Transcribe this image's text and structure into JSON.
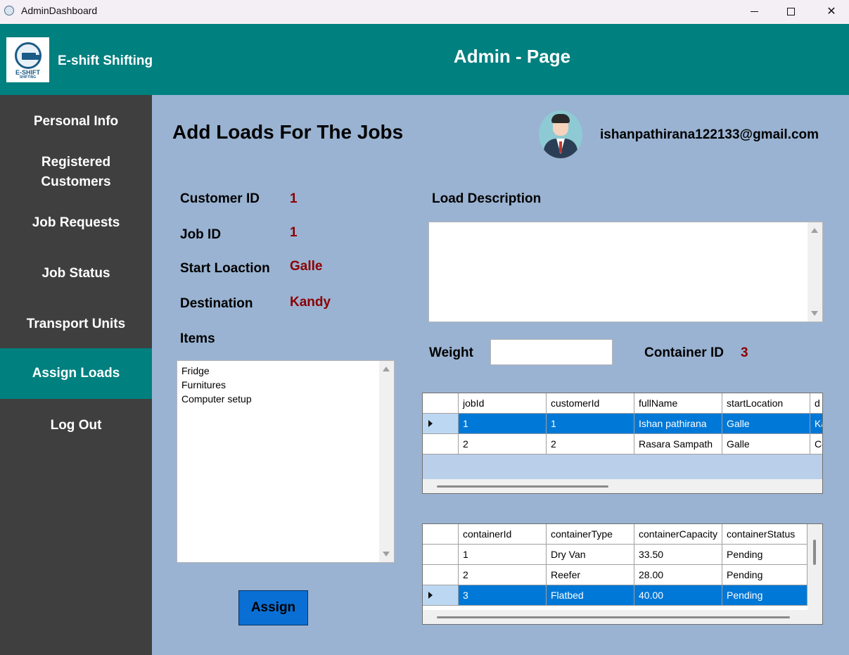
{
  "window": {
    "title": "AdminDashboard",
    "minimize": "",
    "maximize": "",
    "close": "✕"
  },
  "header": {
    "logo_text": "E-SHIFT",
    "logo_sub": "SHIFTING",
    "brand": "E-shift Shifting",
    "title": "Admin - Page"
  },
  "sidebar": {
    "items": [
      {
        "label": "Personal Info"
      },
      {
        "label": "Registered Customers"
      },
      {
        "label": "Job Requests"
      },
      {
        "label": "Job Status"
      },
      {
        "label": "Transport Units"
      },
      {
        "label": "Assign Loads"
      },
      {
        "label": "Log Out"
      }
    ],
    "active": "Assign Loads"
  },
  "main": {
    "title": "Add Loads For The Jobs",
    "user_email": "ishanpathirana122133@gmail.com",
    "fields": {
      "customer_id_label": "Customer ID",
      "customer_id_value": "1",
      "job_id_label": "Job ID",
      "job_id_value": "1",
      "start_location_label": "Start Loaction",
      "start_location_value": "Galle",
      "destination_label": "Destination",
      "destination_value": "Kandy",
      "items_label": "Items",
      "load_description_label": "Load Description",
      "load_description_value": "",
      "weight_label": "Weight",
      "weight_value": "",
      "container_id_label": "Container ID",
      "container_id_value": "3"
    },
    "items": [
      "Fridge",
      "Furnitures",
      "Computer setup"
    ],
    "assign_button": "Assign"
  },
  "jobs_grid": {
    "columns": [
      "jobId",
      "customerId",
      "fullName",
      "startLocation",
      "d"
    ],
    "rows": [
      [
        "1",
        "1",
        "Ishan pathirana",
        "Galle",
        "Ka"
      ],
      [
        "2",
        "2",
        "Rasara Sampath",
        "Galle",
        "Co"
      ]
    ],
    "selected_row": 0
  },
  "containers_grid": {
    "columns": [
      "containerId",
      "containerType",
      "containerCapacity",
      "containerStatus"
    ],
    "rows": [
      [
        "1",
        "Dry Van",
        "33.50",
        "Pending"
      ],
      [
        "2",
        "Reefer",
        "28.00",
        "Pending"
      ],
      [
        "3",
        "Flatbed",
        "40.00",
        "Pending"
      ]
    ],
    "selected_row": 2
  }
}
